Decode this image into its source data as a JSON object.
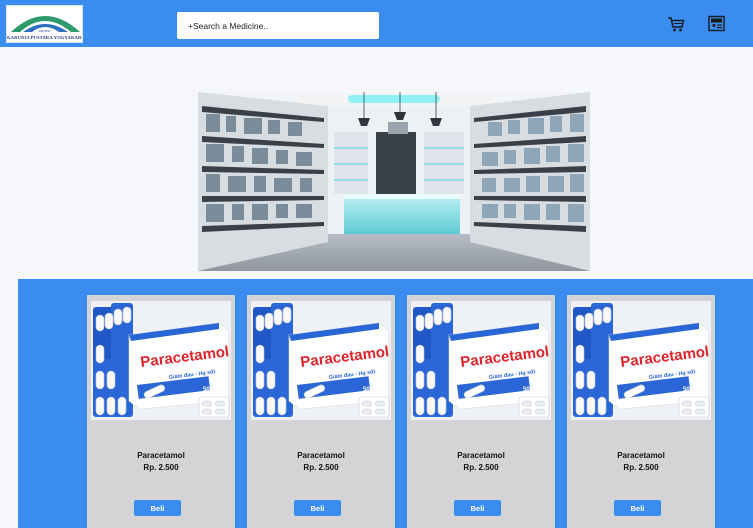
{
  "header": {
    "logo_text": "KARUNIA PUSTAKA YOGYAKARTA",
    "logo_subtext": "APOTEK",
    "search_placeholder": "+Search a Medicine..",
    "cart_icon": "cart-icon",
    "profile_icon": "profile-card-icon"
  },
  "hero": {
    "image": "pharmacy-interior"
  },
  "products": [
    {
      "name": "Paracetamol",
      "price": "Rp. 2.500",
      "button": "Beli",
      "box_text": "Paracetamol",
      "box_sub": "Giảm đau - Hạ sốt",
      "box_dose": "500mg"
    },
    {
      "name": "Paracetamol",
      "price": "Rp. 2.500",
      "button": "Beli",
      "box_text": "Paracetamol",
      "box_sub": "Giảm đau - Hạ sốt",
      "box_dose": "500mg"
    },
    {
      "name": "Paracetamol",
      "price": "Rp. 2.500",
      "button": "Beli",
      "box_text": "Paracetamol",
      "box_sub": "Giảm đau - Hạ sốt",
      "box_dose": "500mg"
    },
    {
      "name": "Paracetamol",
      "price": "Rp. 2.500",
      "button": "Beli",
      "box_text": "Paracetamol",
      "box_sub": "Giảm đau - Hạ sốt",
      "box_dose": "500mg"
    }
  ],
  "colors": {
    "primary": "#3a8cf0",
    "card": "#d4d4d6",
    "background": "#f6f7fb"
  }
}
